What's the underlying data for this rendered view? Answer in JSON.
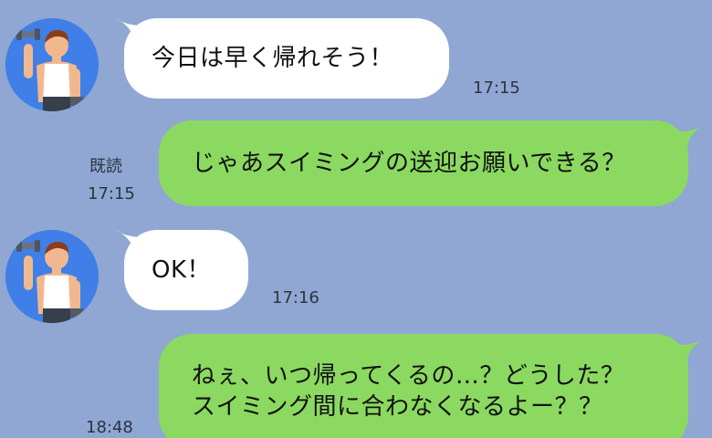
{
  "messages": [
    {
      "side": "incoming",
      "text": "今日は早く帰れそう！",
      "time": "17:15"
    },
    {
      "side": "outgoing",
      "text": "じゃあスイミングの送迎お願いできる？",
      "read": "既読",
      "time": "17:15"
    },
    {
      "side": "incoming",
      "text": "OK！",
      "time": "17:16"
    },
    {
      "side": "outgoing",
      "text_lines": [
        "ねぇ、いつ帰ってくるの…？どうした？",
        "スイミング間に合わなくなるよー？？"
      ],
      "time": "18:48"
    }
  ],
  "colors": {
    "background": "#8fa7d2",
    "incoming_bubble": "#ffffff",
    "outgoing_bubble": "#8bd961",
    "avatar_bg": "#3f7fe7"
  },
  "icons": {
    "avatar": "man-lifting-dumbbell-avatar-icon"
  }
}
